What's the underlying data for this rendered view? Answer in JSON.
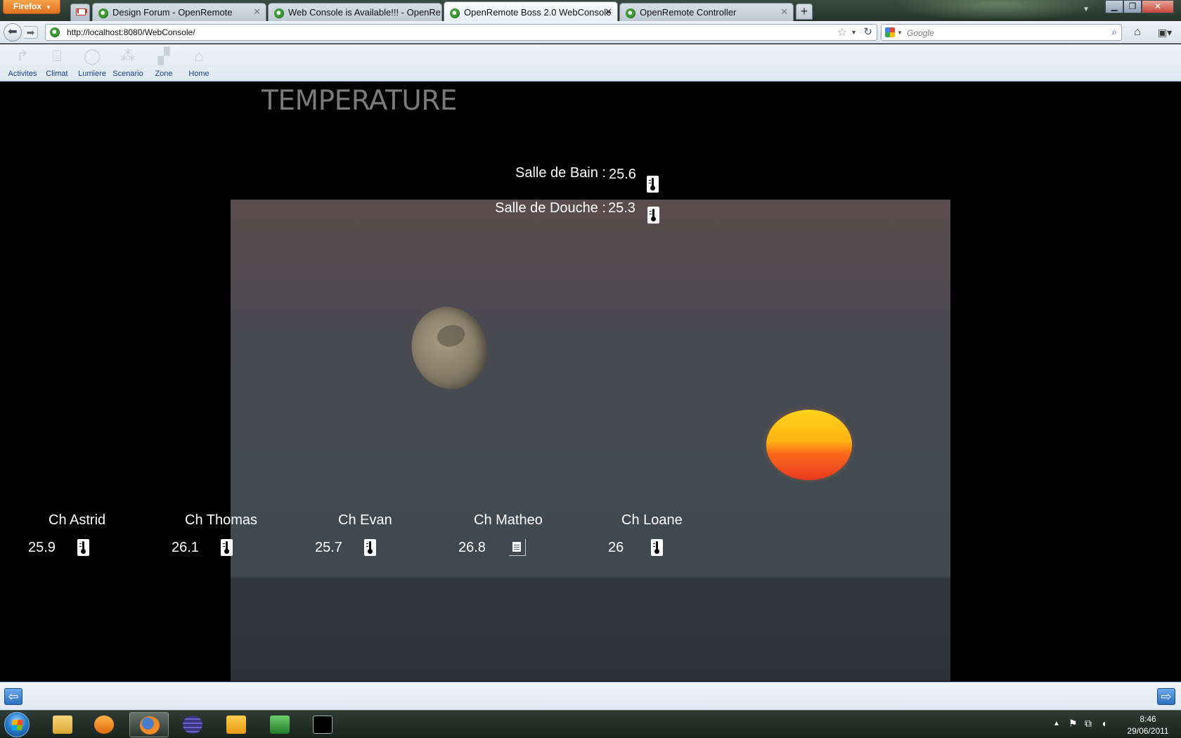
{
  "browser": {
    "menu_button": "Firefox",
    "tabs": [
      {
        "title": "Design Forum - OpenRemote",
        "active": false
      },
      {
        "title": "Web Console is Available!!! - OpenRe...",
        "active": false
      },
      {
        "title": "OpenRemote Boss 2.0 WebConsole",
        "active": true
      },
      {
        "title": "OpenRemote Controller",
        "active": false
      }
    ],
    "new_tab": "+",
    "url": "http://localhost:8080/WebConsole/",
    "search_placeholder": "Google"
  },
  "toolbar": {
    "tabs": [
      {
        "label": "Activites",
        "icon": "activites-icon"
      },
      {
        "label": "Climat",
        "icon": "climat-icon"
      },
      {
        "label": "Lumiere",
        "icon": "lumiere-icon"
      },
      {
        "label": "Scenario",
        "icon": "scenario-icon"
      },
      {
        "label": "Zone",
        "icon": "zone-icon"
      },
      {
        "label": "Home",
        "icon": "home-icon"
      }
    ]
  },
  "screen": {
    "title": "TEMPERATURE",
    "top_sensors": [
      {
        "label": "Salle de Bain :",
        "value": "25.6",
        "icon": "thermometer-icon"
      },
      {
        "label": "Salle de Douche :",
        "value": "25.3",
        "icon": "thermometer-icon"
      }
    ],
    "rooms": [
      {
        "name": "Ch Astrid",
        "value": "25.9",
        "icon": "thermometer-icon"
      },
      {
        "name": "Ch Thomas",
        "value": "26.1",
        "icon": "thermometer-icon"
      },
      {
        "name": "Ch Evan",
        "value": "25.7",
        "icon": "thermometer-icon"
      },
      {
        "name": "Ch Matheo",
        "value": "26.8",
        "icon": "document-icon"
      },
      {
        "name": "Ch Loane",
        "value": "26",
        "icon": "thermometer-icon"
      }
    ]
  },
  "taskbar": {
    "time": "8:46",
    "date": "29/06/2011"
  },
  "colors": {
    "toolbar_label": "#15428b",
    "screen_bg": "#000000",
    "title_text": "#7a7a7a"
  }
}
